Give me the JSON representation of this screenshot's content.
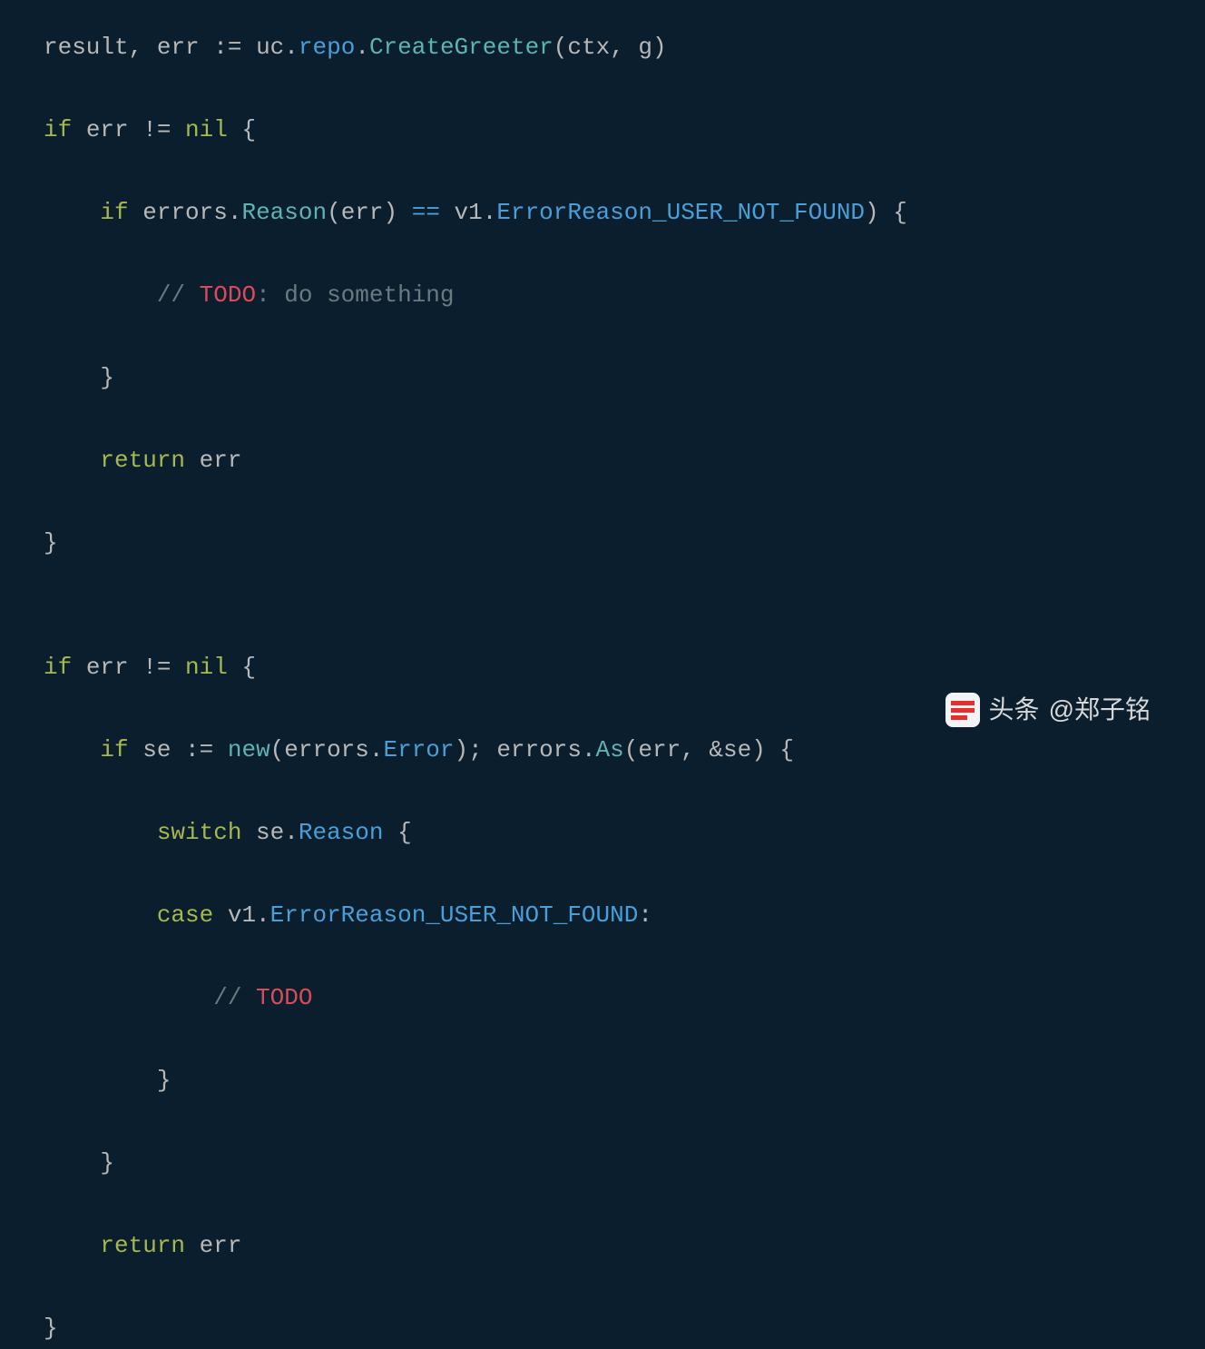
{
  "code": {
    "l1": {
      "t1": "result",
      "t2": ", ",
      "t3": "err",
      "t4": " := ",
      "t5": "uc",
      "t6": ".",
      "t7": "repo",
      "t8": ".",
      "t9": "CreateGreeter",
      "t10": "(",
      "t11": "ctx",
      "t12": ", ",
      "t13": "g",
      "t14": ")"
    },
    "l2": {
      "t1": "if",
      "t2": " err != ",
      "t3": "nil",
      "t4": " {"
    },
    "l3": {
      "t1": "    ",
      "t2": "if",
      "t3": " errors.",
      "t4": "Reason",
      "t5": "(err) ",
      "t6": "==",
      "t7": " v1.",
      "t8": "ErrorReason_USER_NOT_FOUND",
      "t9": ") {"
    },
    "l4": {
      "t1": "        ",
      "t2": "// ",
      "t3": "TODO",
      "t4": ": do something"
    },
    "l5": {
      "t1": "    }"
    },
    "l6": {
      "t1": "    ",
      "t2": "return",
      "t3": " err"
    },
    "l7": {
      "t1": "}"
    },
    "l8": {
      "t1": ""
    },
    "l9": {
      "t1": "if",
      "t2": " err != ",
      "t3": "nil",
      "t4": " {"
    },
    "l10": {
      "t1": "    ",
      "t2": "if",
      "t3": " se := ",
      "t4": "new",
      "t5": "(errors.",
      "t6": "Error",
      "t7": "); errors.",
      "t8": "As",
      "t9": "(err, &se) {"
    },
    "l11": {
      "t1": "        ",
      "t2": "switch",
      "t3": " se.",
      "t4": "Reason",
      "t5": " {"
    },
    "l12": {
      "t1": "        ",
      "t2": "case",
      "t3": " v1.",
      "t4": "ErrorReason_USER_NOT_FOUND",
      "t5": ":"
    },
    "l13": {
      "t1": "            ",
      "t2": "// ",
      "t3": "TODO"
    },
    "l14": {
      "t1": "        }"
    },
    "l15": {
      "t1": "    }"
    },
    "l16": {
      "t1": "    ",
      "t2": "return",
      "t3": " err"
    },
    "l17": {
      "t1": "}"
    }
  },
  "watermark": {
    "label1": "头条",
    "label2": "@郑子铭"
  }
}
